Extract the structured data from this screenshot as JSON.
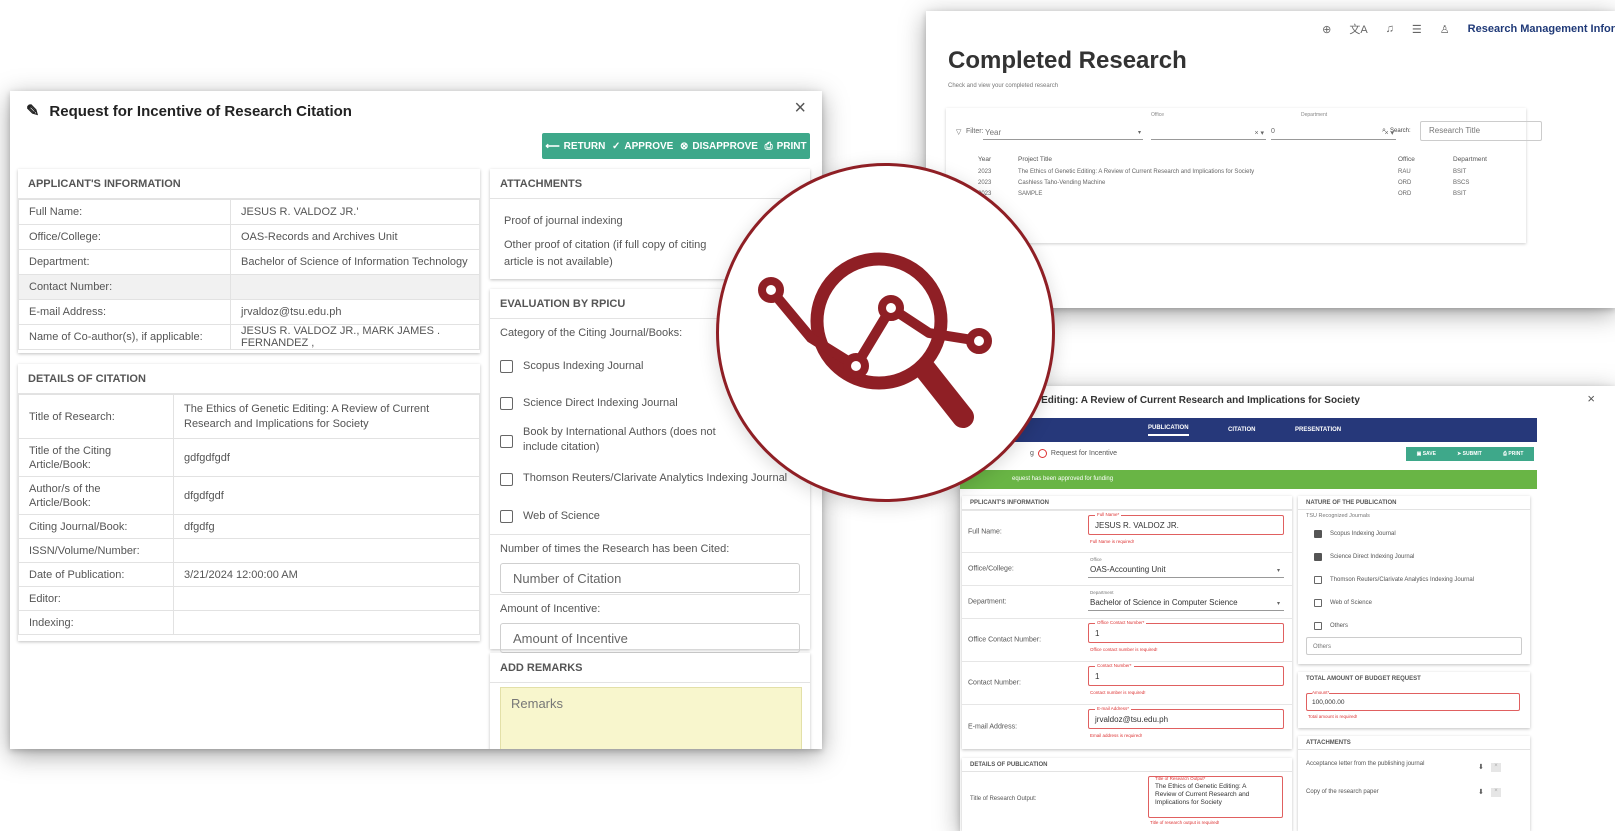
{
  "left_window": {
    "title": "Request for Incentive of Research Citation",
    "close": "×",
    "actions": {
      "return": "RETURN",
      "approve": "APPROVE",
      "disapprove": "DISAPPROVE",
      "print": "PRINT"
    },
    "applicant": {
      "header": "APPLICANT'S INFORMATION",
      "rows": [
        {
          "label": "Full Name:",
          "value": "JESUS R. VALDOZ JR.'"
        },
        {
          "label": "Office/College:",
          "value": "OAS-Records and Archives Unit"
        },
        {
          "label": "Department:",
          "value": "Bachelor of Science of Information Technology"
        },
        {
          "label": "Contact Number:",
          "value": ""
        },
        {
          "label": "E-mail Address:",
          "value": "jrvaldoz@tsu.edu.ph"
        },
        {
          "label": "Name of Co-author(s), if applicable:",
          "value": "JESUS R. VALDOZ JR., MARK JAMES . FERNANDEZ ,"
        }
      ]
    },
    "citation": {
      "header": "DETAILS OF CITATION",
      "rows": [
        {
          "label": "Title of Research:",
          "value": "The Ethics of Genetic Editing: A Review of Current Research and Implications for Society"
        },
        {
          "label": "Title of the Citing Article/Book:",
          "value": "gdfgdfgdf"
        },
        {
          "label": "Author/s of the Article/Book:",
          "value": "dfgdfgdf"
        },
        {
          "label": "Citing Journal/Book:",
          "value": "dfgdfg"
        },
        {
          "label": "ISSN/Volume/Number:",
          "value": ""
        },
        {
          "label": "Date of Publication:",
          "value": "3/21/2024 12:00:00 AM"
        },
        {
          "label": "Editor:",
          "value": ""
        },
        {
          "label": "Indexing:",
          "value": ""
        }
      ]
    },
    "attachments": {
      "header": "ATTACHMENTS",
      "items": [
        "Proof of journal indexing",
        "Other proof of citation (if full copy of citing article is not available)"
      ]
    },
    "evaluation": {
      "header": "EVALUATION BY RPICU",
      "category_label": "Category of the Citing Journal/Books:",
      "options": [
        "Scopus Indexing Journal",
        "Science Direct Indexing Journal",
        "Book by International Authors (does not include citation)",
        "Thomson Reuters/Clarivate Analytics Indexing Journal",
        "Web of Science"
      ],
      "times_cited_label": "Number of times the Research has been Cited:",
      "times_cited_placeholder": "Number of Citation",
      "amount_label": "Amount of Incentive:",
      "amount_placeholder": "Amount of Incentive"
    },
    "remarks": {
      "header": "ADD REMARKS",
      "placeholder": "Remarks"
    }
  },
  "top_right_window": {
    "app_name": "Research Management Infor",
    "page_title": "Completed Research",
    "page_subtitle": "Check and view your completed research",
    "filter_label": "Filter:",
    "year_placeholder": "Year",
    "office_label": "Office",
    "department_label": "Department",
    "department_value": "0",
    "search_label": "Search:",
    "search_placeholder": "Research Title",
    "columns": [
      "Year",
      "Project Title",
      "Office",
      "Department"
    ],
    "rows": [
      [
        "2023",
        "The Ethics of Genetic Editing: A Review of Current Research and Implications for Society",
        "RAU",
        "BSIT"
      ],
      [
        "2023",
        "Cashless Taho-Vending Machine",
        "ORD",
        "BSCS"
      ],
      [
        "2023",
        "SAMPLE",
        "ORD",
        "BSIT"
      ]
    ]
  },
  "bottom_right_window": {
    "title": "ic Editing: A Review of Current Research and Implications for Society",
    "close": "×",
    "tabs": [
      "PUBLICATION",
      "CITATION",
      "PRESENTATION"
    ],
    "radio_prefix": "g",
    "radio_label": "Request for Incentive",
    "actions": {
      "save": "SAVE",
      "submit": "SUBMIT",
      "print": "PRINT"
    },
    "banner": "equest has been approved for funding",
    "applicant": {
      "header": "PPLICANT'S INFORMATION",
      "full_name_label": "Full Name:",
      "full_name_float": "Full Name*",
      "full_name_value": "JESUS R. VALDOZ JR.",
      "full_name_error": "Full Name is required!",
      "office_label": "Office/College:",
      "office_float": "Office",
      "office_value": "OAS-Accounting Unit",
      "department_label": "Department:",
      "department_float": "Department",
      "department_value": "Bachelor of Science in Computer Science",
      "office_contact_label": "Office Contact Number:",
      "office_contact_float": "Office Contact Number*",
      "office_contact_value": "1",
      "office_contact_error": "Office contact number is required!",
      "contact_label": "Contact Number:",
      "contact_float": "Contact Number*",
      "contact_value": "1",
      "contact_error": "Contact number is required!",
      "email_label": "E-mail Address:",
      "email_float": "E-mail Address*",
      "email_value": "jrvaldoz@tsu.edu.ph",
      "email_error": "Email address is required!"
    },
    "nature": {
      "header": "NATURE OF THE PUBLICATION",
      "sub": "TSU Recognized Journals",
      "options": [
        {
          "label": "Scopus Indexing Journal",
          "checked": true
        },
        {
          "label": "Science Direct Indexing Journal",
          "checked": true
        },
        {
          "label": "Thomson Reuters/Clarivate Analytics Indexing Journal",
          "checked": false
        },
        {
          "label": "Web of Science",
          "checked": false
        },
        {
          "label": "Others",
          "checked": false
        }
      ],
      "others_placeholder": "Others"
    },
    "budget": {
      "header": "TOTAL AMOUNT OF BUDGET REQUEST",
      "float": "Amount*",
      "value": "100,000.00",
      "error": "Total amount is required!"
    },
    "publication": {
      "header": "DETAILS OF PUBLICATION",
      "output_label": "Title of Research Output:",
      "output_float": "Title of Research Output*",
      "output_value": "The Ethics of Genetic Editing: A Review of Current Research and Implications for Society",
      "output_error": "Title of research output is required!"
    },
    "attachments": {
      "header": "ATTACHMENTS",
      "items": [
        "Acceptance letter from the publishing journal",
        "Copy of the research paper"
      ]
    }
  },
  "colors": {
    "teal": "#3ea88a",
    "navy": "#26387a",
    "green": "#69b545",
    "maroon": "#8f1f25",
    "error": "#d33333",
    "remarks_bg": "#f8f6cd"
  }
}
